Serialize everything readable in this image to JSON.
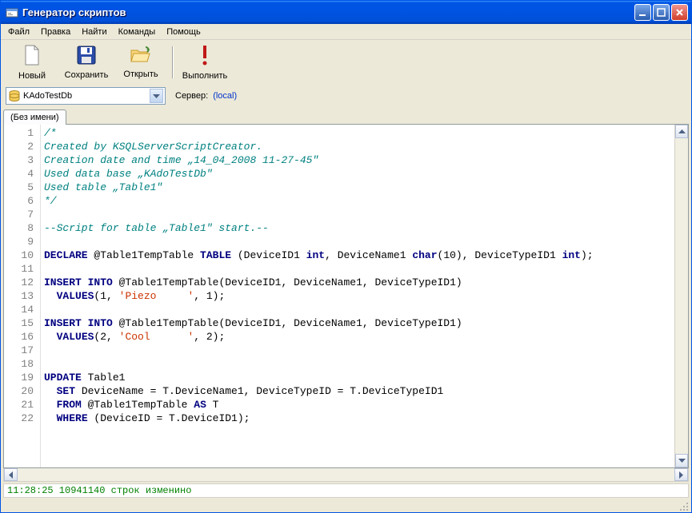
{
  "window": {
    "title": "Генератор скриптов"
  },
  "menu": {
    "items": [
      "Файл",
      "Правка",
      "Найти",
      "Команды",
      "Помощь"
    ]
  },
  "toolbar": {
    "new_label": "Новый",
    "save_label": "Сохранить",
    "open_label": "Открыть",
    "run_label": "Выполнить"
  },
  "dbbar": {
    "db_value": "KAdoTestDb",
    "server_label": "Сервер:",
    "server_value": "(local)"
  },
  "tabs": {
    "items": [
      "(Без имени)"
    ]
  },
  "code": {
    "lines": [
      {
        "n": 1,
        "tokens": [
          {
            "c": "c-comment",
            "t": "/*"
          }
        ]
      },
      {
        "n": 2,
        "tokens": [
          {
            "c": "c-comment",
            "t": "Created by KSQLServerScriptCreator."
          }
        ]
      },
      {
        "n": 3,
        "tokens": [
          {
            "c": "c-comment",
            "t": "Creation date and time „14_04_2008 11-27-45\""
          }
        ]
      },
      {
        "n": 4,
        "tokens": [
          {
            "c": "c-comment",
            "t": "Used data base „KAdoTestDb\""
          }
        ]
      },
      {
        "n": 5,
        "tokens": [
          {
            "c": "c-comment",
            "t": "Used table „Table1\""
          }
        ]
      },
      {
        "n": 6,
        "tokens": [
          {
            "c": "c-comment",
            "t": "*/"
          }
        ]
      },
      {
        "n": 7,
        "tokens": []
      },
      {
        "n": 8,
        "tokens": [
          {
            "c": "c-comment",
            "t": "--Script for table „Table1\" start.--"
          }
        ]
      },
      {
        "n": 9,
        "tokens": []
      },
      {
        "n": 10,
        "tokens": [
          {
            "c": "c-kw",
            "t": "DECLARE"
          },
          {
            "c": "",
            "t": " @Table1TempTable "
          },
          {
            "c": "c-kw",
            "t": "TABLE"
          },
          {
            "c": "",
            "t": " (DeviceID1 "
          },
          {
            "c": "c-kw",
            "t": "int"
          },
          {
            "c": "",
            "t": ", DeviceName1 "
          },
          {
            "c": "c-kw",
            "t": "char"
          },
          {
            "c": "",
            "t": "(10), DeviceTypeID1 "
          },
          {
            "c": "c-kw",
            "t": "int"
          },
          {
            "c": "",
            "t": ");"
          }
        ]
      },
      {
        "n": 11,
        "tokens": []
      },
      {
        "n": 12,
        "tokens": [
          {
            "c": "c-kw",
            "t": "INSERT INTO"
          },
          {
            "c": "",
            "t": " @Table1TempTable(DeviceID1, DeviceName1, DeviceTypeID1)"
          }
        ]
      },
      {
        "n": 13,
        "tokens": [
          {
            "c": "",
            "t": "  "
          },
          {
            "c": "c-kw",
            "t": "VALUES"
          },
          {
            "c": "",
            "t": "(1, "
          },
          {
            "c": "c-str",
            "t": "'Piezo     '"
          },
          {
            "c": "",
            "t": ", 1);"
          }
        ]
      },
      {
        "n": 14,
        "tokens": []
      },
      {
        "n": 15,
        "tokens": [
          {
            "c": "c-kw",
            "t": "INSERT INTO"
          },
          {
            "c": "",
            "t": " @Table1TempTable(DeviceID1, DeviceName1, DeviceTypeID1)"
          }
        ]
      },
      {
        "n": 16,
        "tokens": [
          {
            "c": "",
            "t": "  "
          },
          {
            "c": "c-kw",
            "t": "VALUES"
          },
          {
            "c": "",
            "t": "(2, "
          },
          {
            "c": "c-str",
            "t": "'Cool      '"
          },
          {
            "c": "",
            "t": ", 2);"
          }
        ]
      },
      {
        "n": 17,
        "tokens": []
      },
      {
        "n": 18,
        "tokens": []
      },
      {
        "n": 19,
        "tokens": [
          {
            "c": "c-kw",
            "t": "UPDATE"
          },
          {
            "c": "",
            "t": " Table1"
          }
        ]
      },
      {
        "n": 20,
        "tokens": [
          {
            "c": "",
            "t": "  "
          },
          {
            "c": "c-kw",
            "t": "SET"
          },
          {
            "c": "",
            "t": " DeviceName = T.DeviceName1, DeviceTypeID = T.DeviceTypeID1"
          }
        ]
      },
      {
        "n": 21,
        "tokens": [
          {
            "c": "",
            "t": "  "
          },
          {
            "c": "c-kw",
            "t": "FROM"
          },
          {
            "c": "",
            "t": " @Table1TempTable "
          },
          {
            "c": "c-kw",
            "t": "AS"
          },
          {
            "c": "",
            "t": " T"
          }
        ]
      },
      {
        "n": 22,
        "tokens": [
          {
            "c": "",
            "t": "  "
          },
          {
            "c": "c-kw",
            "t": "WHERE"
          },
          {
            "c": "",
            "t": " (DeviceID = T.DeviceID1);"
          }
        ]
      }
    ]
  },
  "status": {
    "text": "11:28:25 10941140 строк изменино"
  }
}
